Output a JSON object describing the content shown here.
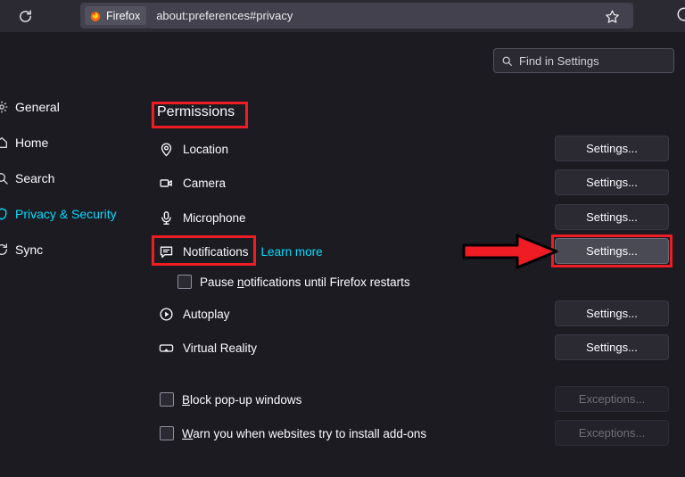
{
  "browser": {
    "reload_icon": "reload-icon",
    "brand_chip": "Firefox",
    "url": "about:preferences#privacy",
    "star_icon": "star-icon"
  },
  "search": {
    "placeholder": "Find in Settings",
    "icon": "search-icon"
  },
  "sidebar": {
    "items": [
      {
        "label": "General",
        "icon": "gear-icon",
        "active": false
      },
      {
        "label": "Home",
        "icon": "home-icon",
        "active": false
      },
      {
        "label": "Search",
        "icon": "search-icon",
        "active": false
      },
      {
        "label": "Privacy & Security",
        "icon": "shield-icon",
        "active": true
      },
      {
        "label": "Sync",
        "icon": "sync-icon",
        "active": false
      }
    ]
  },
  "main": {
    "section_title": "Permissions",
    "permissions": [
      {
        "label": "Location",
        "icon": "location-pin-icon",
        "button": "Settings...",
        "button_accesskey": "t"
      },
      {
        "label": "Camera",
        "icon": "camera-icon",
        "button": "Settings...",
        "button_accesskey": "t"
      },
      {
        "label": "Microphone",
        "icon": "microphone-icon",
        "button": "Settings...",
        "button_accesskey": "t"
      },
      {
        "label": "Notifications",
        "icon": "notification-bubble-icon",
        "button": "Settings...",
        "button_accesskey": "t",
        "link": "Learn more",
        "highlighted": true
      },
      {
        "label": "Autoplay",
        "icon": "autoplay-icon",
        "button": "Settings...",
        "button_accesskey": "t"
      },
      {
        "label": "Virtual Reality",
        "icon": "vr-goggles-icon",
        "button": "Settings...",
        "button_accesskey": "t"
      }
    ],
    "pause_notifications": {
      "label_before": "Pause ",
      "accesskey": "n",
      "label_after": "otifications until Firefox restarts",
      "checked": false
    },
    "options": [
      {
        "label_before": "",
        "accesskey": "B",
        "label_after": "lock pop-up windows",
        "checked": false,
        "button": "Exceptions...",
        "button_accesskey": "E",
        "button_disabled": true
      },
      {
        "label_before": "",
        "accesskey": "W",
        "label_after": "arn you when websites try to install add-ons",
        "checked": false,
        "button": "Exceptions...",
        "button_accesskey": "E",
        "button_disabled": true
      }
    ]
  },
  "annotations": {
    "highlight_color": "#ef1c24",
    "arrow_color": "#ef1c24",
    "boxes": [
      "permissions-heading",
      "notifications-row",
      "notifications-settings-button"
    ],
    "arrow_points_to": "notifications-settings-button"
  },
  "colors": {
    "background": "#1c1b22",
    "toolbar": "#2b2a33",
    "urlbar": "#42414d",
    "accent": "#00ddff",
    "text": "#fbfbfe"
  }
}
